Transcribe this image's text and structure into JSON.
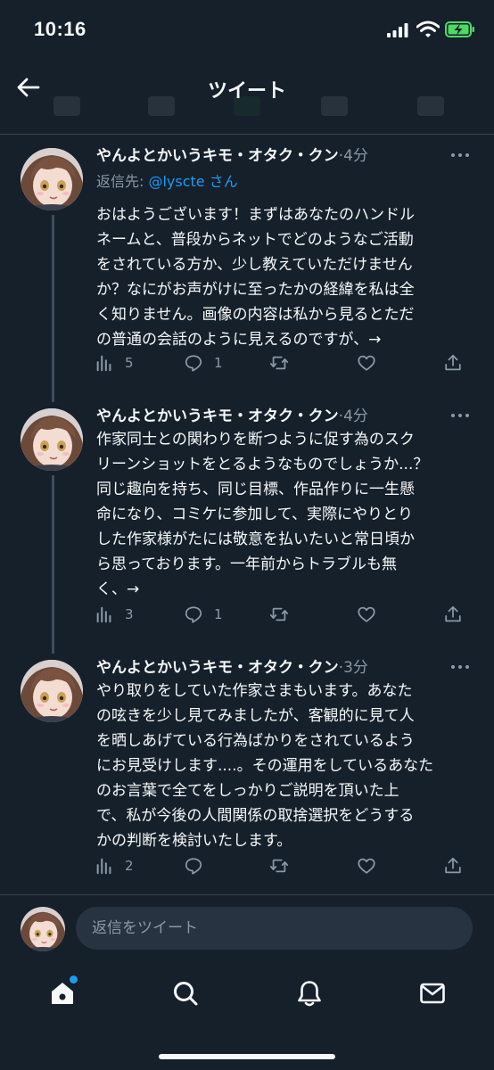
{
  "status_bar": {
    "time": "10:16",
    "icons": [
      "signal-icon",
      "wifi-icon",
      "battery-charging-icon"
    ]
  },
  "header": {
    "title": "ツイート",
    "back_icon": "back-arrow-icon"
  },
  "tweets": [
    {
      "author": "やんよとかいうキモ・オタク・クン",
      "separator": "·",
      "time": "4分",
      "reply_prefix": "返信先: ",
      "reply_handle": "@lyscte",
      "reply_suffix": " さん",
      "lines": [
        "おはようございます！まずはあなたのハンドル",
        "ネームと、普段からネットでどのようなご活動",
        "をされている方か、少し教えていただけません",
        "か？なにがお声がけに至ったかの経緯を私は全",
        "く知りません。画像の内容は私から見るとただ",
        "の普通の会話のように見えるのですが、→"
      ],
      "views": "5",
      "replies": "1"
    },
    {
      "author": "やんよとかいうキモ・オタク・クン",
      "separator": "·",
      "time": "4分",
      "lines": [
        "作家同士との関わりを断つように促す為のスク",
        "リーンショットをとるようなものでしょうか...？",
        "同じ趣向を持ち、同じ目標、作品作りに一生懸",
        "命になり、コミケに参加して、実際にやりとり",
        "した作家様がたには敬意を払いたいと常日頃か",
        "ら思っております。一年前からトラブルも無",
        "く、→"
      ],
      "views": "3",
      "replies": "1"
    },
    {
      "author": "やんよとかいうキモ・オタク・クン",
      "separator": "·",
      "time": "3分",
      "lines": [
        "やり取りをしていた作家さまもいます。あなた",
        "の呟きを少し見てみましたが、客観的に見て人",
        "を晒しあげている行為ばかりをされているよう",
        "にお見受けします....。その運用をしているあなた",
        "のお言葉で全てをしっかりご説明を頂いた上",
        "で、私が今後の人間関係の取捨選択をどうする",
        "かの判断を検討いたします。"
      ],
      "views": "2",
      "replies": ""
    }
  ],
  "reply_bar": {
    "placeholder": "返信をツイート"
  },
  "bottom_nav": {
    "items": [
      "home-icon",
      "search-icon",
      "notifications-icon",
      "messages-icon"
    ]
  },
  "colors": {
    "background": "#15202b",
    "text": "#f7f9f9",
    "secondary": "#8b98a5",
    "accent": "#1d9bf0",
    "divider": "#38444d"
  }
}
